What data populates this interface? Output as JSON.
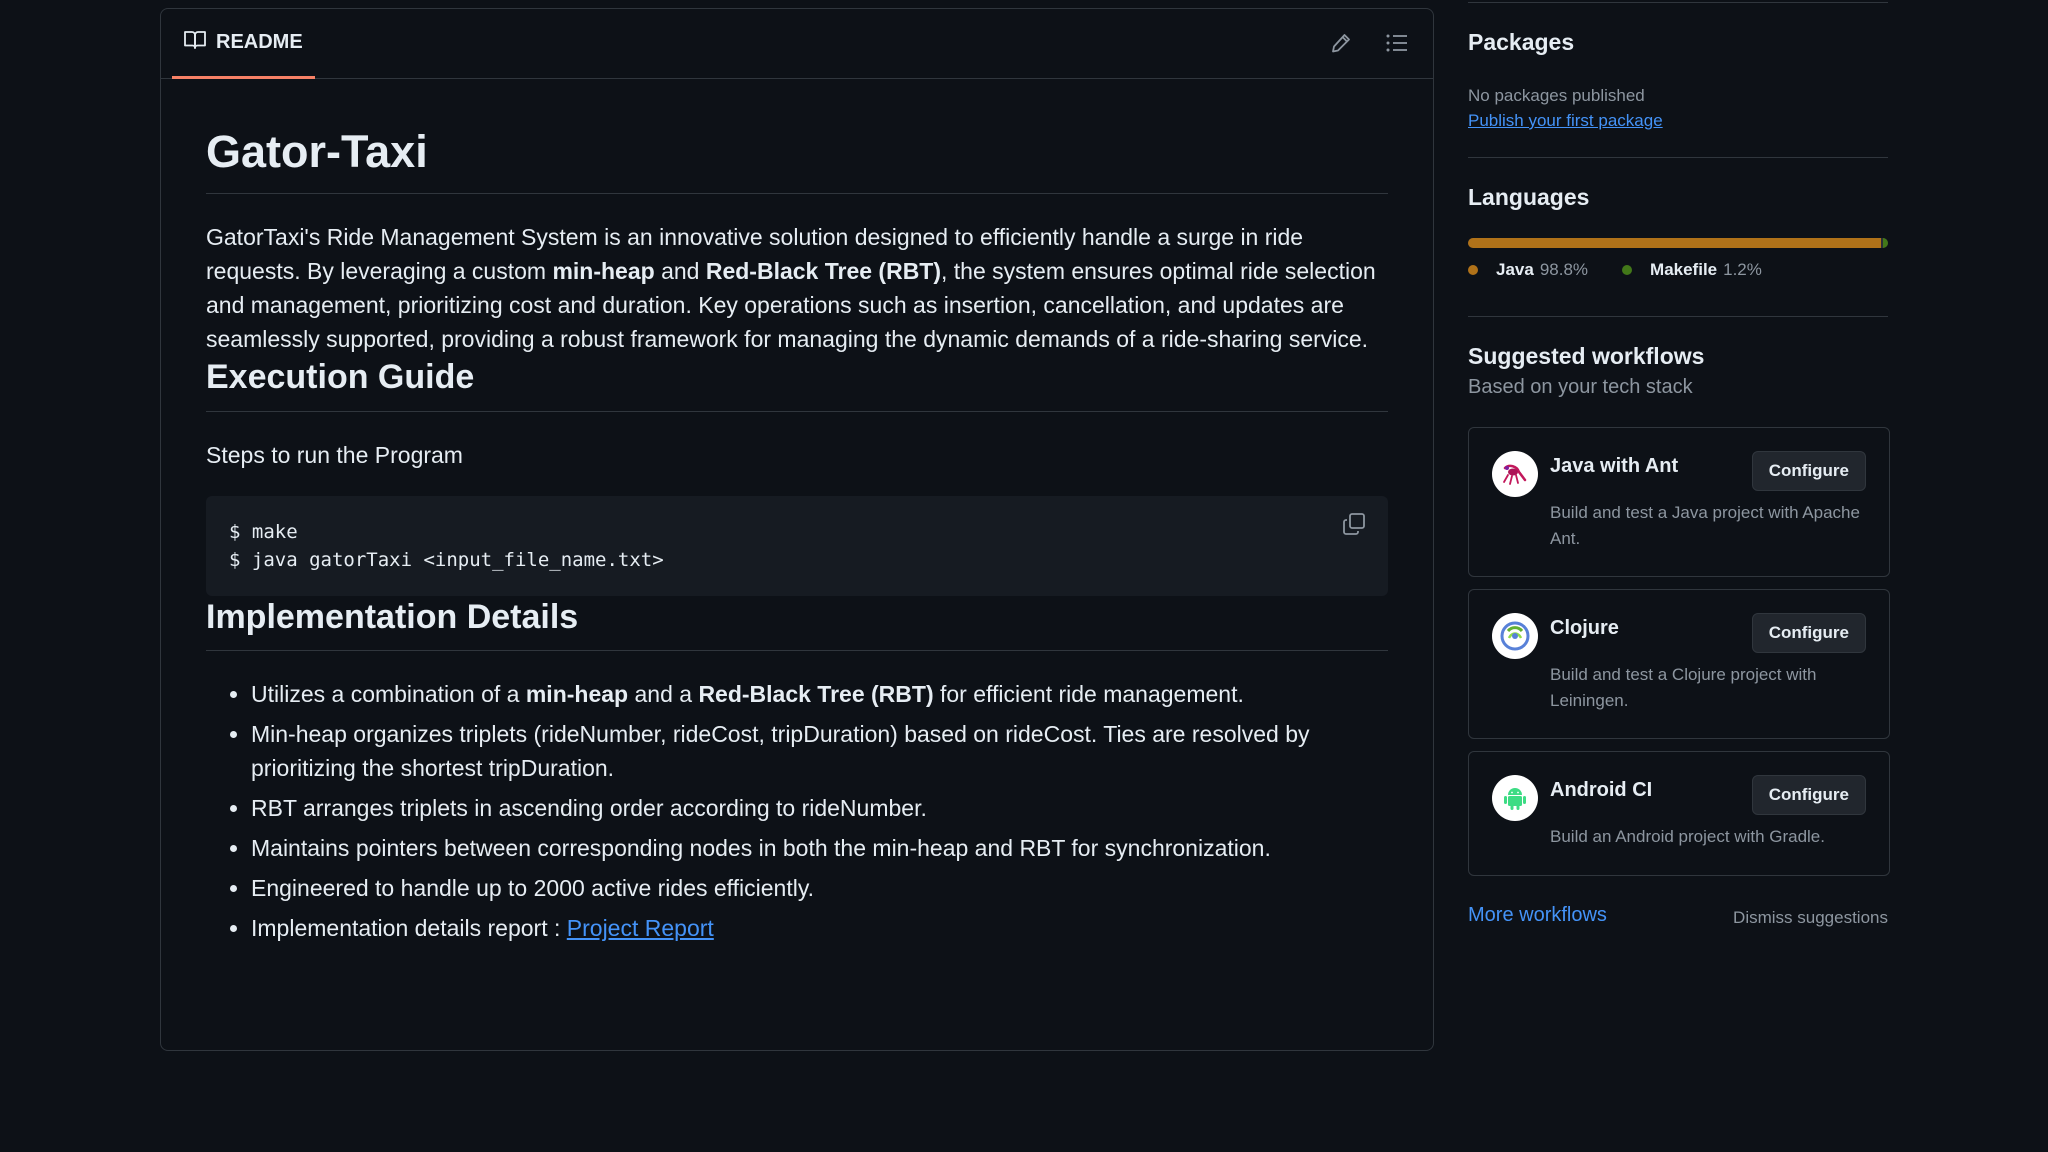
{
  "readme": {
    "tab_label": "README",
    "title": "Gator-Taxi",
    "intro": {
      "p1": "GatorTaxi's Ride Management System is an innovative solution designed to efficiently handle a surge in ride requests. By leveraging a custom ",
      "b1": "min-heap",
      "p2": " and ",
      "b2": "Red-Black Tree (RBT)",
      "p3": ", the system ensures optimal ride selection and management, prioritizing cost and duration. Key operations such as insertion, cancellation, and updates are seamlessly supported, providing a robust framework for managing the dynamic demands of a ride-sharing service."
    },
    "execution_heading": "Execution Guide",
    "steps_text": "Steps to run the Program",
    "code_lines": [
      "$ make",
      "$ java gatorTaxi <input_file_name.txt>"
    ],
    "implementation_heading": "Implementation Details",
    "bullets": {
      "b1": {
        "t1": "Utilizes a combination of a ",
        "s1": "min-heap",
        "t2": " and a ",
        "s2": "Red-Black Tree (RBT)",
        "t3": " for efficient ride management."
      },
      "b2": "Min-heap organizes triplets (rideNumber, rideCost, tripDuration) based on rideCost. Ties are resolved by prioritizing the shortest tripDuration.",
      "b3": "RBT arranges triplets in ascending order according to rideNumber.",
      "b4": "Maintains pointers between corresponding nodes in both the min-heap and RBT for synchronization.",
      "b5": "Engineered to handle up to 2000 active rides efficiently.",
      "b6_prefix": "Implementation details report : ",
      "b6_link": "Project Report"
    }
  },
  "sidebar": {
    "packages": {
      "heading": "Packages",
      "none_text": "No packages published",
      "publish_link": "Publish your first package"
    },
    "languages": {
      "heading": "Languages",
      "items": [
        {
          "name": "Java",
          "percent": "98.8%",
          "value": 98.8,
          "color": "#b07219"
        },
        {
          "name": "Makefile",
          "percent": "1.2%",
          "value": 1.2,
          "color": "#427819"
        }
      ]
    },
    "workflows": {
      "heading": "Suggested workflows",
      "subheading": "Based on your tech stack",
      "configure_label": "Configure",
      "items": [
        {
          "title": "Java with Ant",
          "description": "Build and test a Java project with Apache Ant.",
          "icon": "ant-icon"
        },
        {
          "title": "Clojure",
          "description": "Build and test a Clojure project with Leiningen.",
          "icon": "clojure-icon"
        },
        {
          "title": "Android CI",
          "description": "Build an Android project with Gradle.",
          "icon": "android-icon"
        }
      ],
      "more_link": "More workflows",
      "dismiss_label": "Dismiss suggestions"
    }
  },
  "colors": {
    "background": "#0d1117",
    "border": "#30363d",
    "text": "#e6edf3",
    "muted": "#8d96a0",
    "link": "#4493f8",
    "tab_underline": "#f78166",
    "code_bg": "#161b22"
  }
}
